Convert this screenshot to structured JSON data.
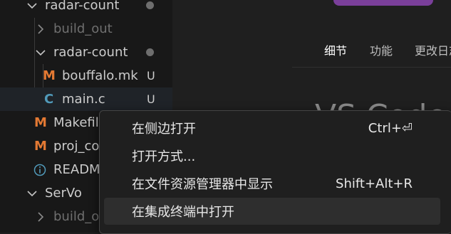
{
  "sidebar": {
    "items": [
      {
        "label": "radar-count",
        "badge": "dot"
      },
      {
        "label": "build_out"
      },
      {
        "label": "radar-count",
        "badge": "dot"
      },
      {
        "label": "bouffalo.mk",
        "icon": "M",
        "badge": "U"
      },
      {
        "label": "main.c",
        "icon": "C",
        "badge": "U"
      },
      {
        "label": "Makefile",
        "icon": "M"
      },
      {
        "label": "proj_con",
        "icon": "M"
      },
      {
        "label": "READM",
        "icon": "i"
      },
      {
        "label": "SerVo"
      },
      {
        "label": "build_o"
      }
    ]
  },
  "editor": {
    "tabs": [
      "细节",
      "功能",
      "更改日志"
    ],
    "title_fragment": "VS Code M",
    "edge_text": [
      "e",
      "er"
    ]
  },
  "context_menu": {
    "items": [
      {
        "label": "在侧边打开",
        "shortcut": "Ctrl+⏎"
      },
      {
        "label": "打开方式...",
        "shortcut": ""
      },
      {
        "label": "在文件资源管理器中显示",
        "shortcut": "Shift+Alt+R"
      },
      {
        "label": "在集成终端中打开",
        "shortcut": "",
        "highlighted": true
      }
    ]
  },
  "colors": {
    "makefile_icon": "#e37933",
    "c_icon": "#519aba",
    "accent_button": "#7a3f9a"
  }
}
